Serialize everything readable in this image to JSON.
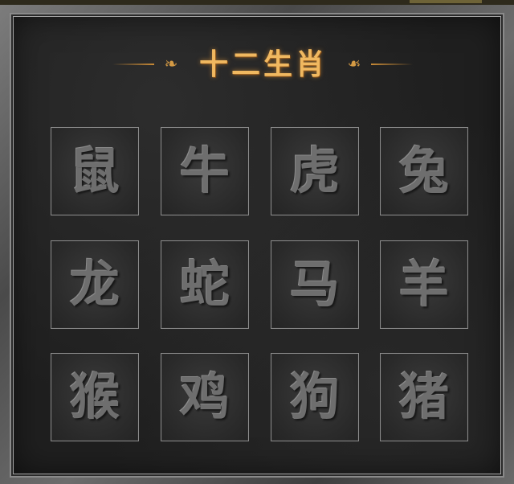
{
  "title": "十二生肖",
  "decoration": {
    "left_ornament_icon": "cloud-scroll-icon",
    "right_ornament_icon": "cloud-scroll-icon",
    "accent_color": "#d49a44"
  },
  "zodiac": [
    {
      "label": "鼠"
    },
    {
      "label": "牛"
    },
    {
      "label": "虎"
    },
    {
      "label": "兔"
    },
    {
      "label": "龙"
    },
    {
      "label": "蛇"
    },
    {
      "label": "马"
    },
    {
      "label": "羊"
    },
    {
      "label": "猴"
    },
    {
      "label": "鸡"
    },
    {
      "label": "狗"
    },
    {
      "label": "猪"
    }
  ]
}
